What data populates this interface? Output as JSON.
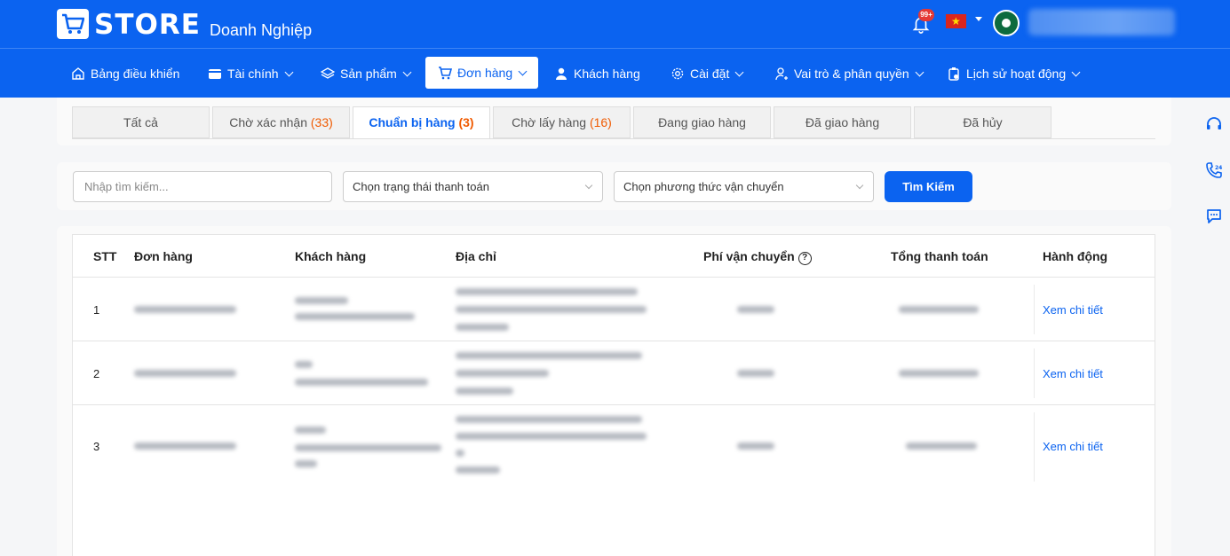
{
  "header": {
    "logo_text": "STORE",
    "subtitle": "Doanh Nghiệp",
    "notification_badge": "99+",
    "brand_color": "#0b63f0"
  },
  "nav": {
    "items": [
      {
        "label": "Bảng điều khiển",
        "icon": "home-icon"
      },
      {
        "label": "Tài chính",
        "icon": "wallet-icon"
      },
      {
        "label": "Sản phẩm",
        "icon": "layers-icon"
      },
      {
        "label": "Đơn hàng",
        "icon": "cart-icon"
      },
      {
        "label": "Khách hàng",
        "icon": "user-icon"
      },
      {
        "label": "Cài đặt",
        "icon": "gear-icon"
      },
      {
        "label": "Vai trò & phân quyền",
        "icon": "role-icon"
      },
      {
        "label": "Lịch sử hoạt động",
        "icon": "clipboard-icon"
      }
    ],
    "active": "Đơn hàng"
  },
  "tabs": [
    {
      "label": "Tất cả",
      "count": ""
    },
    {
      "label": "Chờ xác nhận",
      "count": "(33)"
    },
    {
      "label": "Chuẩn bị hàng",
      "count": "(3)"
    },
    {
      "label": "Chờ lấy hàng",
      "count": "(16)"
    },
    {
      "label": "Đang giao hàng",
      "count": ""
    },
    {
      "label": "Đã giao hàng",
      "count": ""
    },
    {
      "label": "Đã hủy",
      "count": ""
    }
  ],
  "active_tab": "Chuẩn bị hàng",
  "filters": {
    "search_placeholder": "Nhập tìm kiếm...",
    "payment_status_placeholder": "Chọn trạng thái thanh toán",
    "shipping_method_placeholder": "Chọn phương thức vận chuyển",
    "search_button": "Tìm Kiếm"
  },
  "table": {
    "columns": [
      "STT",
      "Đơn hàng",
      "Khách hàng",
      "Địa chỉ",
      "Phí vận chuyển",
      "Tổng thanh toán",
      "Hành động"
    ],
    "help_icon": "question-circle-icon",
    "rows": [
      {
        "stt": "1",
        "action": "Xem chi tiết"
      },
      {
        "stt": "2",
        "action": "Xem chi tiết"
      },
      {
        "stt": "3",
        "action": "Xem chi tiết"
      }
    ]
  },
  "right_rail": [
    "headset-icon",
    "phone-call-icon",
    "chat-icon"
  ]
}
